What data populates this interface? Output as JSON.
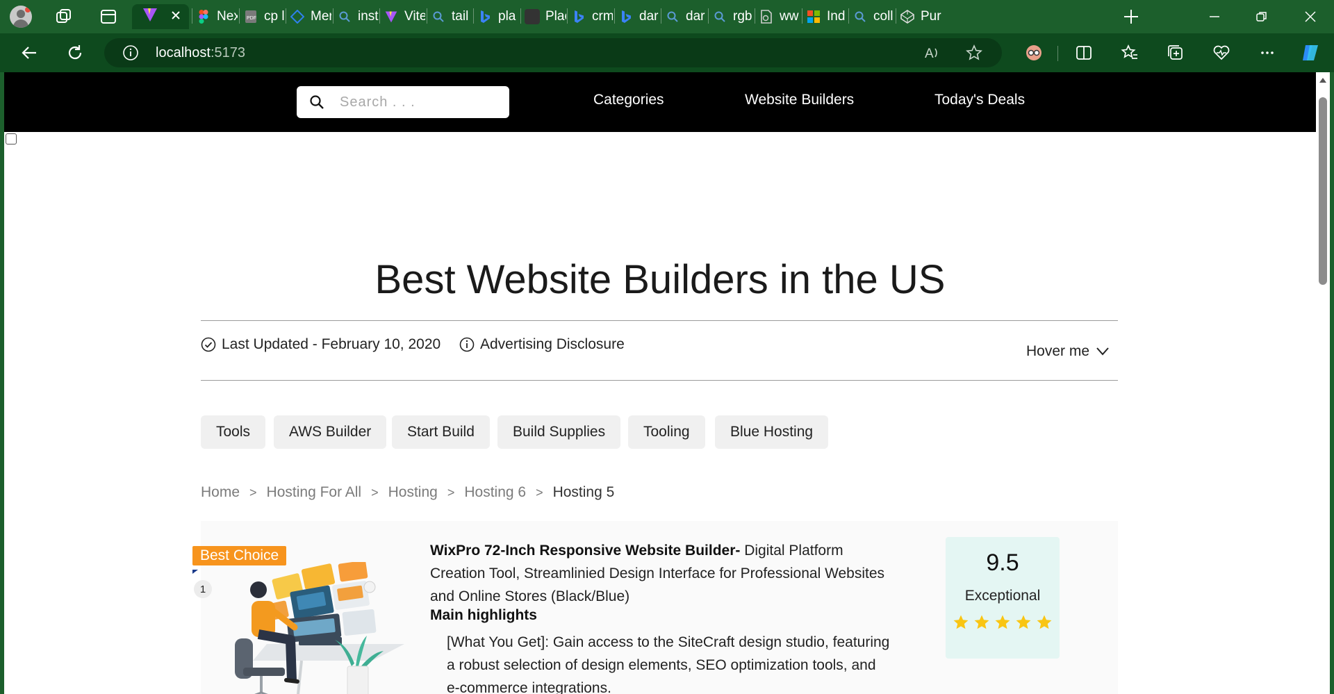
{
  "browser": {
    "tabs": [
      {
        "label": "Nex",
        "icon": "figma-icon",
        "color": "#f24e1e"
      },
      {
        "label": "cp l",
        "icon": "pdf-icon",
        "color": "#6b6b6b"
      },
      {
        "label": "Mer",
        "icon": "diagram-icon",
        "color": "#2f80ed"
      },
      {
        "label": "inst",
        "icon": "search-icon",
        "color": "#5b9bd5"
      },
      {
        "label": "Vite",
        "icon": "vite-icon",
        "color": "#a855f7"
      },
      {
        "label": "tail",
        "icon": "search-icon",
        "color": "#5b9bd5"
      },
      {
        "label": "pla",
        "icon": "bing-icon",
        "color": "#3b82f6"
      },
      {
        "label": "Plac",
        "icon": "dark-site-icon",
        "color": "#333333"
      },
      {
        "label": "crm",
        "icon": "bing-icon",
        "color": "#3b82f6"
      },
      {
        "label": "dar",
        "icon": "bing-icon",
        "color": "#3b82f6"
      },
      {
        "label": "dar",
        "icon": "search-icon",
        "color": "#5b9bd5"
      },
      {
        "label": "rgb",
        "icon": "search-icon",
        "color": "#5b9bd5"
      },
      {
        "label": "ww",
        "icon": "page-icon",
        "color": "#6b6b6b"
      },
      {
        "label": "Ind",
        "icon": "microsoft-icon",
        "color": "#f25022"
      },
      {
        "label": "coll",
        "icon": "search-icon",
        "color": "#5b9bd5"
      },
      {
        "label": "Pur",
        "icon": "codepen-icon",
        "color": "#444444"
      }
    ],
    "url_host": "localhost",
    "url_port": ":5173"
  },
  "nav": {
    "search_placeholder": "Search . . .",
    "links": [
      "Categories",
      "Website Builders",
      "Today's Deals"
    ]
  },
  "page": {
    "title": "Best Website Builders in the US",
    "last_updated": "Last Updated - February 10, 2020",
    "disclosure": "Advertising Disclosure",
    "hover_label": "Hover me"
  },
  "chips": [
    "Tools",
    "AWS Builder",
    "Start Build",
    "Build Supplies",
    "Tooling",
    "Blue Hosting"
  ],
  "breadcrumbs": [
    "Home",
    "Hosting For All",
    "Hosting",
    "Hosting 6",
    "Hosting 5"
  ],
  "product": {
    "badge": "Best Choice",
    "rank": "1",
    "name": "WixPro 72-Inch Responsive Website Builder-",
    "description": " Digital Platform Creation Tool, Streamlinied Design Interface for Professional Websites and Online Stores (Black/Blue)",
    "highlights_title": "Main highlights",
    "highlight": "[What You Get]: Gain access to the SiteCraft design studio, featuring a robust selection of design elements, SEO optimization tools, and e-commerce integrations.",
    "score": "9.5",
    "score_label": "Exceptional",
    "stars": 5,
    "colors": {
      "badge": "#f7941d",
      "score_bg": "#e4f6f3",
      "star": "#f9c513"
    }
  }
}
